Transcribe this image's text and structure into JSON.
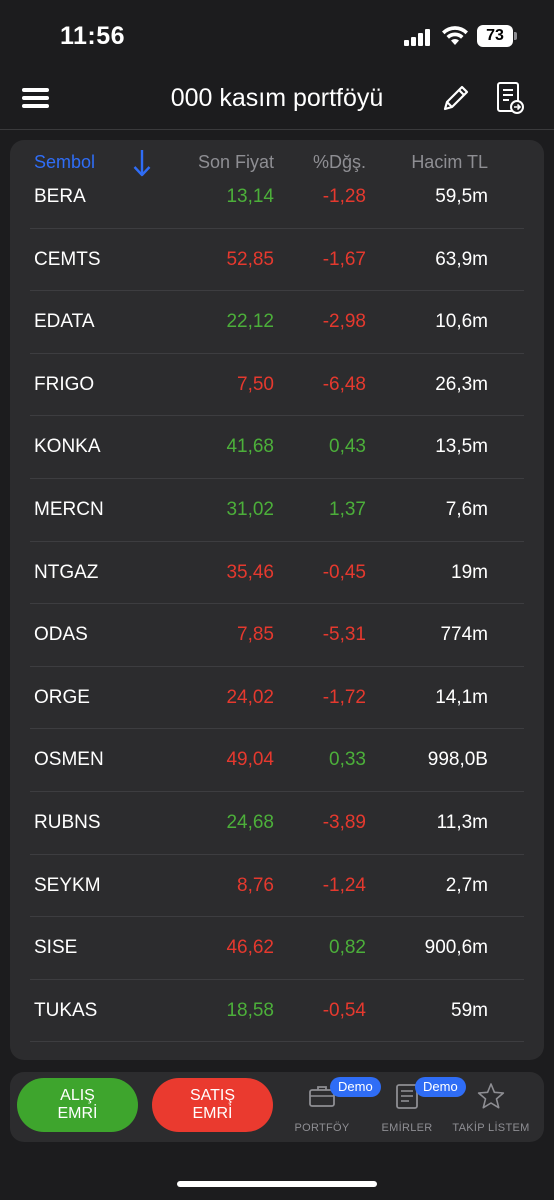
{
  "status": {
    "time": "11:56",
    "battery": "73"
  },
  "header": {
    "title": "000 kasım portföyü"
  },
  "table": {
    "headers": {
      "symbol": "Sembol",
      "price": "Son Fiyat",
      "change": "%Dğş.",
      "volume": "Hacim TL"
    },
    "rows": [
      {
        "symbol": "BERA",
        "price": "13,14",
        "price_color": "#4caf3a",
        "change": "-1,28",
        "change_color": "#e5392e",
        "volume": "59,5m"
      },
      {
        "symbol": "CEMTS",
        "price": "52,85",
        "price_color": "#e5392e",
        "change": "-1,67",
        "change_color": "#e5392e",
        "volume": "63,9m"
      },
      {
        "symbol": "EDATA",
        "price": "22,12",
        "price_color": "#4caf3a",
        "change": "-2,98",
        "change_color": "#e5392e",
        "volume": "10,6m"
      },
      {
        "symbol": "FRIGO",
        "price": "7,50",
        "price_color": "#e5392e",
        "change": "-6,48",
        "change_color": "#e5392e",
        "volume": "26,3m"
      },
      {
        "symbol": "KONKA",
        "price": "41,68",
        "price_color": "#4caf3a",
        "change": "0,43",
        "change_color": "#4caf3a",
        "volume": "13,5m"
      },
      {
        "symbol": "MERCN",
        "price": "31,02",
        "price_color": "#4caf3a",
        "change": "1,37",
        "change_color": "#4caf3a",
        "volume": "7,6m"
      },
      {
        "symbol": "NTGAZ",
        "price": "35,46",
        "price_color": "#e5392e",
        "change": "-0,45",
        "change_color": "#e5392e",
        "volume": "19m"
      },
      {
        "symbol": "ODAS",
        "price": "7,85",
        "price_color": "#e5392e",
        "change": "-5,31",
        "change_color": "#e5392e",
        "volume": "774m"
      },
      {
        "symbol": "ORGE",
        "price": "24,02",
        "price_color": "#e5392e",
        "change": "-1,72",
        "change_color": "#e5392e",
        "volume": "14,1m"
      },
      {
        "symbol": "OSMEN",
        "price": "49,04",
        "price_color": "#e5392e",
        "change": "0,33",
        "change_color": "#4caf3a",
        "volume": "998,0B"
      },
      {
        "symbol": "RUBNS",
        "price": "24,68",
        "price_color": "#4caf3a",
        "change": "-3,89",
        "change_color": "#e5392e",
        "volume": "11,3m"
      },
      {
        "symbol": "SEYKM",
        "price": "8,76",
        "price_color": "#e5392e",
        "change": "-1,24",
        "change_color": "#e5392e",
        "volume": "2,7m"
      },
      {
        "symbol": "SISE",
        "price": "46,62",
        "price_color": "#e5392e",
        "change": "0,82",
        "change_color": "#4caf3a",
        "volume": "900,6m"
      },
      {
        "symbol": "TUKAS",
        "price": "18,58",
        "price_color": "#4caf3a",
        "change": "-0,54",
        "change_color": "#e5392e",
        "volume": "59m"
      }
    ]
  },
  "bottom": {
    "buy": {
      "line1": "ALIŞ",
      "line2": "EMRİ"
    },
    "sell": {
      "line1": "SATIŞ",
      "line2": "EMRİ"
    },
    "tabs": {
      "portfoy": {
        "label": "PORTFÖY",
        "badge": "Demo",
        "icon": "briefcase-icon"
      },
      "emirler": {
        "label": "EMİRLER",
        "badge": "Demo",
        "icon": "document-list-icon"
      },
      "takip": {
        "label": "TAKİP LİSTEM",
        "icon": "star-icon"
      }
    }
  },
  "colors": {
    "accent": "#2f6df6",
    "up": "#4caf3a",
    "down": "#e5392e",
    "buy": "#3ea52d",
    "sell": "#ea3a2f"
  }
}
